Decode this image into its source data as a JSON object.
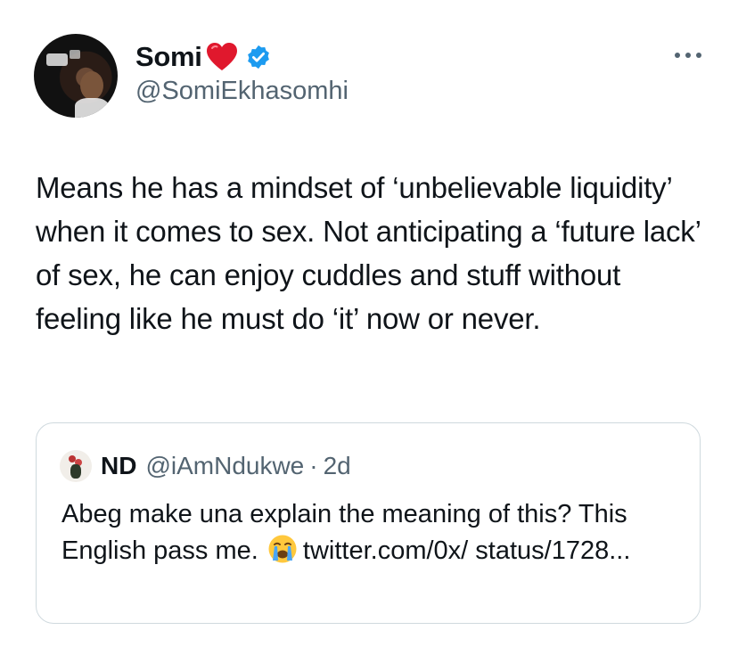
{
  "author": {
    "display_name": "Somi",
    "handle": "@SomiEkhasomhi",
    "name_emoji": "heart-icon",
    "verified": true,
    "verified_color": "#1d9bf0"
  },
  "tweet": {
    "text": "Means he has a mindset of ‘unbelievable liquidity’ when it comes to sex. Not anticipating a ‘future lack’ of sex, he can enjoy cuddles and stuff without feeling like he must do ‘it’ now or never."
  },
  "quoted_tweet": {
    "display_name": "ND",
    "handle": "@iAmNdukwe",
    "separator": "·",
    "time": "2d",
    "text_before_emoji": "Abeg make una explain the meaning of this? This English pass me.",
    "emoji": "crying-face-icon",
    "text_after_emoji": "twitter.com/0x/ status/1728..."
  },
  "colors": {
    "text": "#0f1419",
    "secondary": "#536471",
    "border": "#cfd9de",
    "heart": "#e0182d"
  }
}
